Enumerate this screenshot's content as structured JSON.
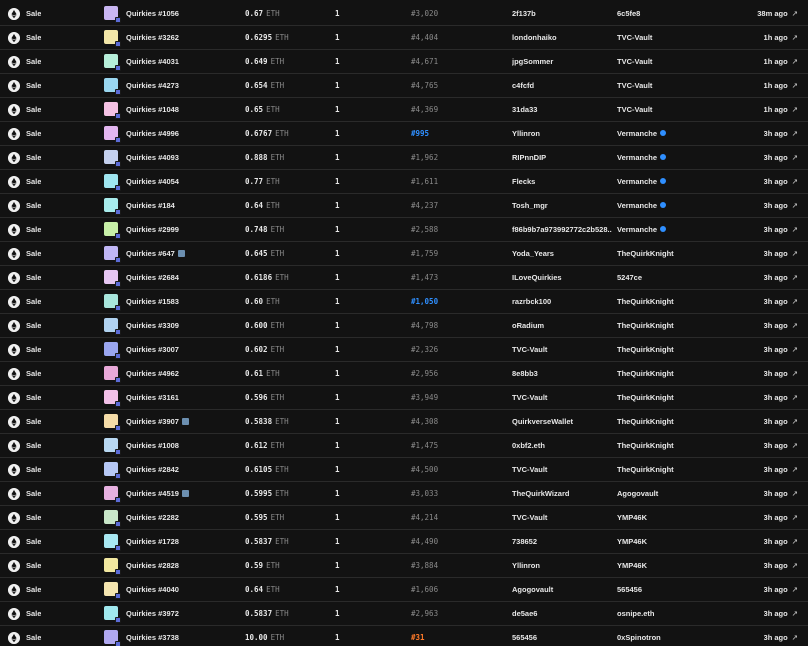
{
  "event_label": "Sale",
  "price_unit": "ETH",
  "rows": [
    {
      "name": "Quirkies #1056",
      "price": "0.67",
      "qty": "1",
      "rank": "#3,020",
      "rank_style": "normal",
      "from": "2f137b",
      "to": "6c5fe8",
      "to_verified": false,
      "time": "38m ago",
      "rare": false,
      "thumb": "#c9b6f2"
    },
    {
      "name": "Quirkies #3262",
      "price": "0.6295",
      "qty": "1",
      "rank": "#4,404",
      "rank_style": "normal",
      "from": "londonhaiko",
      "to": "TVC-Vault",
      "to_verified": false,
      "time": "1h ago",
      "rare": false,
      "thumb": "#f2e6a8"
    },
    {
      "name": "Quirkies #4031",
      "price": "0.649",
      "qty": "1",
      "rank": "#4,671",
      "rank_style": "normal",
      "from": "jpgSommer",
      "to": "TVC-Vault",
      "to_verified": false,
      "time": "1h ago",
      "rare": false,
      "thumb": "#b6eed9"
    },
    {
      "name": "Quirkies #4273",
      "price": "0.654",
      "qty": "1",
      "rank": "#4,765",
      "rank_style": "normal",
      "from": "c4fcfd",
      "to": "TVC-Vault",
      "to_verified": false,
      "time": "1h ago",
      "rare": false,
      "thumb": "#9ad7f0"
    },
    {
      "name": "Quirkies #1048",
      "price": "0.65",
      "qty": "1",
      "rank": "#4,369",
      "rank_style": "normal",
      "from": "31da33",
      "to": "TVC-Vault",
      "to_verified": false,
      "time": "1h ago",
      "rare": false,
      "thumb": "#f5c2e4"
    },
    {
      "name": "Quirkies #4996",
      "price": "0.6767",
      "qty": "1",
      "rank": "#995",
      "rank_style": "blue",
      "from": "Yllinron",
      "to": "Vermanche",
      "to_verified": true,
      "time": "3h ago",
      "rare": false,
      "thumb": "#e3b6f0"
    },
    {
      "name": "Quirkies #4093",
      "price": "0.888",
      "qty": "1",
      "rank": "#1,962",
      "rank_style": "normal",
      "from": "RIPnnDIP",
      "to": "Vermanche",
      "to_verified": true,
      "time": "3h ago",
      "rare": false,
      "thumb": "#c4d0ee"
    },
    {
      "name": "Quirkies #4054",
      "price": "0.77",
      "qty": "1",
      "rank": "#1,611",
      "rank_style": "normal",
      "from": "Flecks",
      "to": "Vermanche",
      "to_verified": true,
      "time": "3h ago",
      "rare": false,
      "thumb": "#9fe6f0"
    },
    {
      "name": "Quirkies #184",
      "price": "0.64",
      "qty": "1",
      "rank": "#4,237",
      "rank_style": "normal",
      "from": "Tosh_mgr",
      "to": "Vermanche",
      "to_verified": true,
      "time": "3h ago",
      "rare": false,
      "thumb": "#a8ecec"
    },
    {
      "name": "Quirkies #2999",
      "price": "0.748",
      "qty": "1",
      "rank": "#2,588",
      "rank_style": "normal",
      "from": "f86b9b7a973992772c2b528...",
      "to": "Vermanche",
      "to_verified": true,
      "time": "3h ago",
      "rare": false,
      "thumb": "#c8f0a8"
    },
    {
      "name": "Quirkies #647",
      "price": "0.645",
      "qty": "1",
      "rank": "#1,759",
      "rank_style": "normal",
      "from": "Yoda_Years",
      "to": "TheQuirkKnight",
      "to_verified": false,
      "time": "3h ago",
      "rare": true,
      "thumb": "#c0b6f5"
    },
    {
      "name": "Quirkies #2684",
      "price": "0.6186",
      "qty": "1",
      "rank": "#1,473",
      "rank_style": "normal",
      "from": "ILoveQuirkies",
      "to": "5247ce",
      "to_verified": false,
      "time": "3h ago",
      "rare": false,
      "thumb": "#e6c6f2"
    },
    {
      "name": "Quirkies #1583",
      "price": "0.60",
      "qty": "1",
      "rank": "#1,050",
      "rank_style": "blue",
      "from": "razrbck100",
      "to": "TheQuirkKnight",
      "to_verified": false,
      "time": "3h ago",
      "rare": false,
      "thumb": "#a8e6dc"
    },
    {
      "name": "Quirkies #3309",
      "price": "0.600",
      "qty": "1",
      "rank": "#4,798",
      "rank_style": "normal",
      "from": "oRadium",
      "to": "TheQuirkKnight",
      "to_verified": false,
      "time": "3h ago",
      "rare": false,
      "thumb": "#b0d2f0"
    },
    {
      "name": "Quirkies #3007",
      "price": "0.602",
      "qty": "1",
      "rank": "#2,326",
      "rank_style": "normal",
      "from": "TVC-Vault",
      "to": "TheQuirkKnight",
      "to_verified": false,
      "time": "3h ago",
      "rare": false,
      "thumb": "#9aa6f0"
    },
    {
      "name": "Quirkies #4962",
      "price": "0.61",
      "qty": "1",
      "rank": "#2,956",
      "rank_style": "normal",
      "from": "8e8bb3",
      "to": "TheQuirkKnight",
      "to_verified": false,
      "time": "3h ago",
      "rare": false,
      "thumb": "#e8a8d8"
    },
    {
      "name": "Quirkies #3161",
      "price": "0.596",
      "qty": "1",
      "rank": "#3,949",
      "rank_style": "normal",
      "from": "TVC-Vault",
      "to": "TheQuirkKnight",
      "to_verified": false,
      "time": "3h ago",
      "rare": false,
      "thumb": "#f2c0e8"
    },
    {
      "name": "Quirkies #3907",
      "price": "0.5838",
      "qty": "1",
      "rank": "#4,308",
      "rank_style": "normal",
      "from": "QuirkverseWallet",
      "to": "TheQuirkKnight",
      "to_verified": false,
      "time": "3h ago",
      "rare": true,
      "thumb": "#f5dca8"
    },
    {
      "name": "Quirkies #1008",
      "price": "0.612",
      "qty": "1",
      "rank": "#1,475",
      "rank_style": "normal",
      "from": "0xbf2.eth",
      "to": "TheQuirkKnight",
      "to_verified": false,
      "time": "3h ago",
      "rare": false,
      "thumb": "#b8d8f2"
    },
    {
      "name": "Quirkies #2842",
      "price": "0.6105",
      "qty": "1",
      "rank": "#4,500",
      "rank_style": "normal",
      "from": "TVC-Vault",
      "to": "TheQuirkKnight",
      "to_verified": false,
      "time": "3h ago",
      "rare": false,
      "thumb": "#b6c8f5"
    },
    {
      "name": "Quirkies #4519",
      "price": "0.5995",
      "qty": "1",
      "rank": "#3,033",
      "rank_style": "normal",
      "from": "TheQuirkWizard",
      "to": "Agogovault",
      "to_verified": false,
      "time": "3h ago",
      "rare": true,
      "thumb": "#e6b0e0"
    },
    {
      "name": "Quirkies #2282",
      "price": "0.595",
      "qty": "1",
      "rank": "#4,214",
      "rank_style": "normal",
      "from": "TVC-Vault",
      "to": "YMP46K",
      "to_verified": false,
      "time": "3h ago",
      "rare": false,
      "thumb": "#c8e6c8"
    },
    {
      "name": "Quirkies #1728",
      "price": "0.5837",
      "qty": "1",
      "rank": "#4,490",
      "rank_style": "normal",
      "from": "738652",
      "to": "YMP46K",
      "to_verified": false,
      "time": "3h ago",
      "rare": false,
      "thumb": "#a8e8f2"
    },
    {
      "name": "Quirkies #2828",
      "price": "0.59",
      "qty": "1",
      "rank": "#3,884",
      "rank_style": "normal",
      "from": "Yllinron",
      "to": "YMP46K",
      "to_verified": false,
      "time": "3h ago",
      "rare": false,
      "thumb": "#f2e8a0"
    },
    {
      "name": "Quirkies #4040",
      "price": "0.64",
      "qty": "1",
      "rank": "#1,606",
      "rank_style": "normal",
      "from": "Agogovault",
      "to": "565456",
      "to_verified": false,
      "time": "3h ago",
      "rare": false,
      "thumb": "#f5e6b0"
    },
    {
      "name": "Quirkies #3972",
      "price": "0.5837",
      "qty": "1",
      "rank": "#2,963",
      "rank_style": "normal",
      "from": "de5ae6",
      "to": "osnipe.eth",
      "to_verified": false,
      "time": "3h ago",
      "rare": false,
      "thumb": "#a0e8ee"
    },
    {
      "name": "Quirkies #3738",
      "price": "10.00",
      "qty": "1",
      "rank": "#31",
      "rank_style": "orange",
      "from": "565456",
      "to": "0xSpinotron",
      "to_verified": false,
      "time": "3h ago",
      "rare": false,
      "thumb": "#b0a8f0"
    }
  ]
}
